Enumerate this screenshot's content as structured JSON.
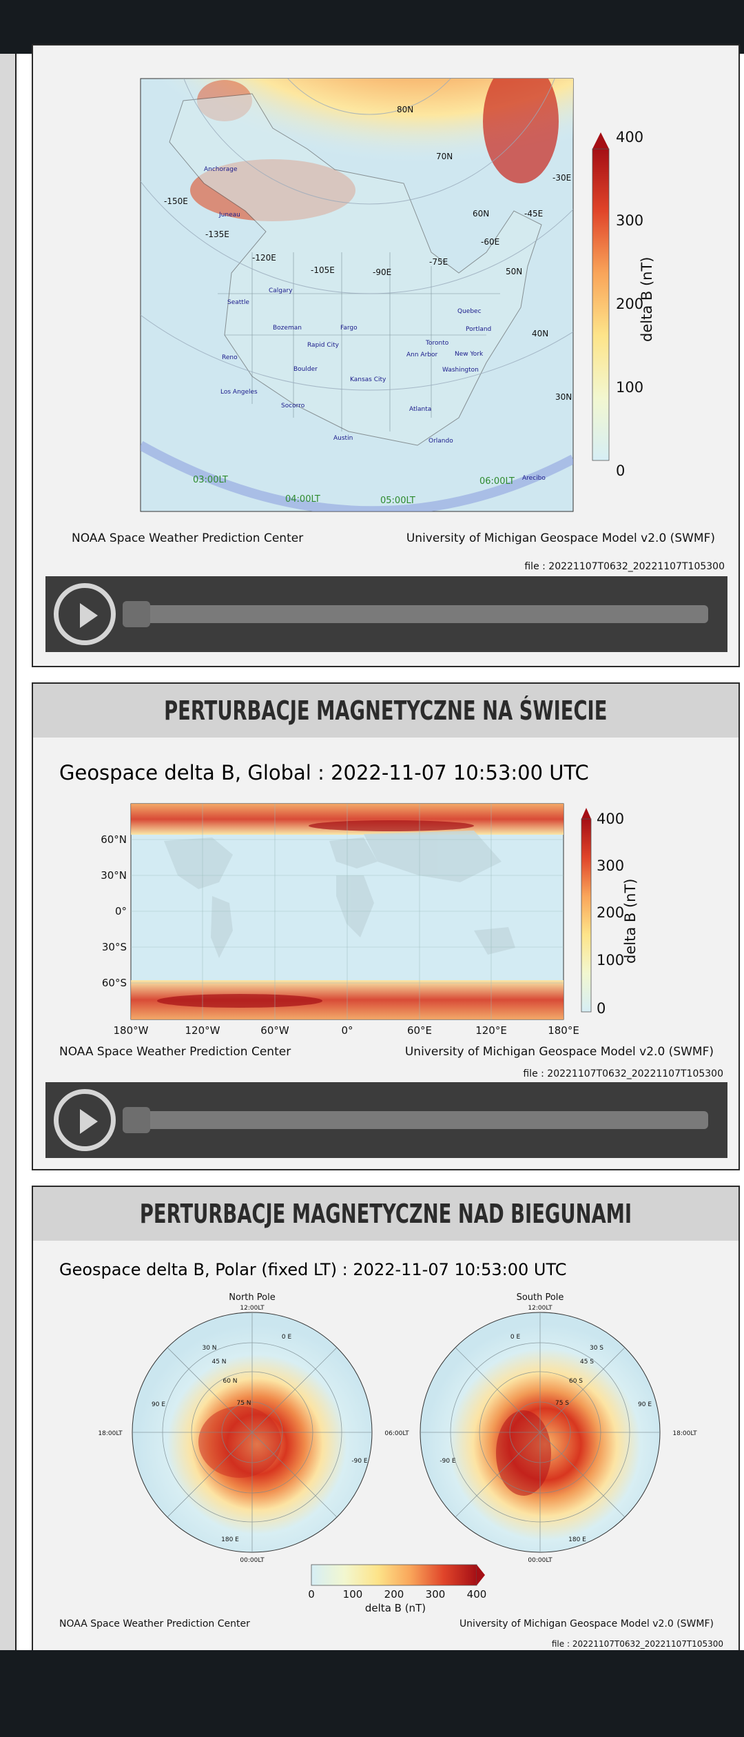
{
  "colors": {
    "bar": "#161b1f",
    "panel": "#f2f2f2",
    "header": "#d3d3d3",
    "player": "#3c3c3c"
  },
  "panel1": {
    "credit_left": "NOAA Space Weather Prediction Center",
    "credit_right": "University of Michigan Geospace Model v2.0 (SWMF)",
    "file": "file : 20221107T0632_20221107T105300",
    "colorbar": {
      "label": "delta B (nT)",
      "ticks": [
        "400",
        "300",
        "200",
        "100",
        "0"
      ]
    },
    "map_labels": {
      "lat": [
        "80N",
        "70N",
        "60N",
        "50N",
        "40N",
        "30N"
      ],
      "lon": [
        "-150E",
        "-135E",
        "-120E",
        "-105E",
        "-90E",
        "-75E",
        "-60E",
        "-45E",
        "-30E"
      ],
      "cities": [
        "Anchorage",
        "Juneau",
        "Calgary",
        "Seattle",
        "Bozeman",
        "Fargo",
        "Rapid City",
        "Reno",
        "Boulder",
        "Kansas City",
        "Los Angeles",
        "Socorro",
        "Austin",
        "Atlanta",
        "Orlando",
        "Ann Arbor",
        "Toronto",
        "Quebec",
        "Portland",
        "New York",
        "Washington",
        "Arecibo"
      ],
      "lt": [
        "03:00LT",
        "04:00LT",
        "05:00LT",
        "06:00LT"
      ]
    },
    "play_icon": "play-icon"
  },
  "panel2": {
    "header": "PERTURBACJE MAGNETYCZNE NA ŚWIECIE",
    "title": "Geospace delta B, Global : 2022-11-07  10:53:00 UTC",
    "yticks": [
      "60°N",
      "30°N",
      "0°",
      "30°S",
      "60°S"
    ],
    "xticks": [
      "180°W",
      "120°W",
      "60°W",
      "0°",
      "60°E",
      "120°E",
      "180°E"
    ],
    "colorbar": {
      "label": "delta B (nT)",
      "ticks": [
        "400",
        "300",
        "200",
        "100",
        "0"
      ]
    },
    "credit_left": "NOAA Space Weather Prediction Center",
    "credit_right": "University of Michigan Geospace Model v2.0 (SWMF)",
    "file": "file : 20221107T0632_20221107T105300"
  },
  "panel3": {
    "header": "PERTURBACJE MAGNETYCZNE NAD BIEGUNAMI",
    "title": "Geospace delta B, Polar (fixed LT) : 2022-11-07  10:53:00 UTC",
    "north": {
      "title": "North Pole",
      "top": "12:00LT",
      "left": "18:00LT",
      "right": "06:00LT",
      "bottom": "00:00LT",
      "lat": [
        "30 N",
        "45 N",
        "60 N",
        "75 N"
      ],
      "lon": [
        "0 E",
        "90 E",
        "-90 E",
        "180 E"
      ]
    },
    "south": {
      "title": "South Pole",
      "top": "12:00LT",
      "left": "18:00LT",
      "right": "06:00LT",
      "bottom": "00:00LT",
      "lat": [
        "30 S",
        "45 S",
        "60 S",
        "75 S"
      ],
      "lon": [
        "0 E",
        "90 E",
        "-90 E",
        "180 E"
      ]
    },
    "colorbar": {
      "label": "delta B (nT)",
      "ticks": [
        "0",
        "100",
        "200",
        "300",
        "400"
      ]
    },
    "credit_left": "NOAA Space Weather Prediction Center",
    "credit_right": "University of Michigan Geospace Model v2.0 (SWMF)",
    "file": "file : 20221107T0632_20221107T105300"
  }
}
